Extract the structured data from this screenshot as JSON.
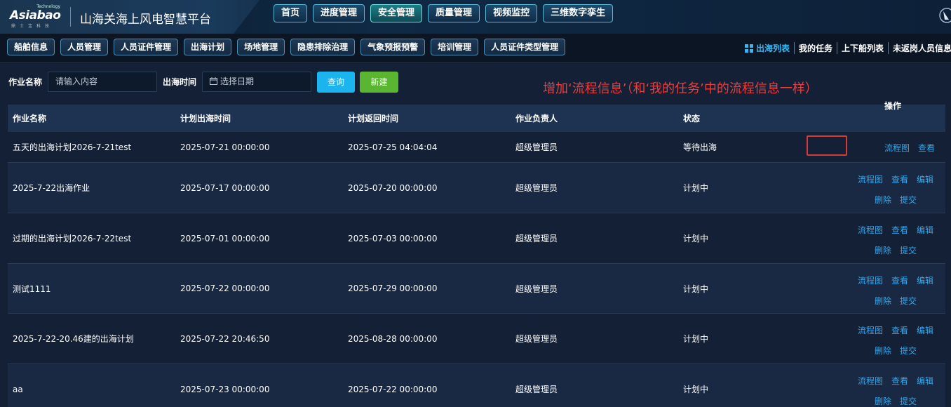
{
  "brand": {
    "logo_tech": "Technology",
    "logo_main": "Asiabao",
    "logo_sub": "鼎士宝科技",
    "title": "山海关海上风电智慧平台"
  },
  "main_nav": [
    {
      "label": "首页",
      "active": false
    },
    {
      "label": "进度管理",
      "active": false
    },
    {
      "label": "安全管理",
      "active": true
    },
    {
      "label": "质量管理",
      "active": false
    },
    {
      "label": "视频监控",
      "active": false
    },
    {
      "label": "三维数字孪生",
      "active": false
    }
  ],
  "sub_nav": [
    "船舶信息",
    "人员管理",
    "人员证件管理",
    "出海计划",
    "场地管理",
    "隐患排除治理",
    "气象预报预警",
    "培训管理",
    "人员证件类型管理"
  ],
  "right_links": [
    "出海列表",
    "我的任务",
    "上下船列表",
    "未返岗人员信息"
  ],
  "filters": {
    "name_label": "作业名称",
    "name_placeholder": "请输入内容",
    "time_label": "出海时间",
    "time_placeholder": "选择日期",
    "query_label": "查询",
    "new_label": "新建"
  },
  "annotation": "增加‘流程信息’（和‘我的任务’中的流程信息一样）",
  "table": {
    "headers": [
      "作业名称",
      "计划出海时间",
      "计划返回时间",
      "作业负责人",
      "状态",
      "操作"
    ],
    "rows": [
      {
        "name": "五天的出海计划2026-7-21test",
        "depart": "2025-07-21 00:00:00",
        "return": "2025-07-25 04:04:04",
        "owner": "超级管理员",
        "status": "等待出海",
        "actions": [
          "流程图",
          "查看"
        ]
      },
      {
        "name": "2025-7-22出海作业",
        "depart": "2025-07-17 00:00:00",
        "return": "2025-07-20 00:00:00",
        "owner": "超级管理员",
        "status": "计划中",
        "actions": [
          "流程图",
          "查看",
          "编辑",
          "删除",
          "提交"
        ]
      },
      {
        "name": "过期的出海计划2026-7-22test",
        "depart": "2025-07-01 00:00:00",
        "return": "2025-07-03 00:00:00",
        "owner": "超级管理员",
        "status": "计划中",
        "actions": [
          "流程图",
          "查看",
          "编辑",
          "删除",
          "提交"
        ]
      },
      {
        "name": "测试1111",
        "depart": "2025-07-22 00:00:00",
        "return": "2025-07-29 00:00:00",
        "owner": "超级管理员",
        "status": "计划中",
        "actions": [
          "流程图",
          "查看",
          "编辑",
          "删除",
          "提交"
        ]
      },
      {
        "name": "2025-7-22-20.46建的出海计划",
        "depart": "2025-07-22 20:46:50",
        "return": "2025-08-28 00:00:00",
        "owner": "超级管理员",
        "status": "计划中",
        "actions": [
          "流程图",
          "查看",
          "编辑",
          "删除",
          "提交"
        ]
      },
      {
        "name": "aa",
        "depart": "2025-07-23 00:00:00",
        "return": "2025-07-22 00:00:00",
        "owner": "超级管理员",
        "status": "计划中",
        "actions": [
          "流程图",
          "查看",
          "编辑",
          "删除",
          "提交"
        ]
      }
    ]
  },
  "colors": {
    "accent": "#1cb4ee",
    "new_button": "#5ab531",
    "link": "#39a6e8",
    "annotation": "#ee3d3d",
    "active_tab": "#1c7f86"
  }
}
